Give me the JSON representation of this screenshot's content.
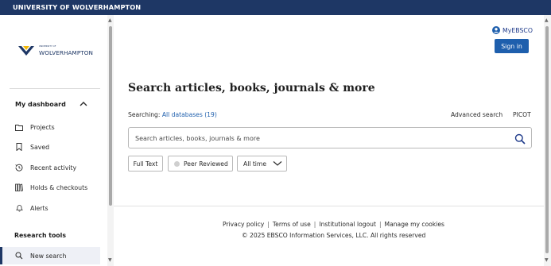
{
  "topbar": {
    "title": "UNIVERSITY OF WOLVERHAMPTON"
  },
  "logo": {
    "small_text": "UNIVERSITY OF",
    "name": "WOLVERHAMPTON"
  },
  "sidebar": {
    "dashboard_heading": "My dashboard",
    "items": [
      {
        "label": "Projects",
        "icon": "folder-icon"
      },
      {
        "label": "Saved",
        "icon": "bookmark-icon"
      },
      {
        "label": "Recent activity",
        "icon": "history-icon"
      },
      {
        "label": "Holds & checkouts",
        "icon": "books-icon"
      },
      {
        "label": "Alerts",
        "icon": "bell-icon"
      }
    ],
    "tools_heading": "Research tools",
    "active_item": {
      "label": "New search",
      "icon": "search-icon"
    }
  },
  "header": {
    "myebsco_label": "MyEBSCO",
    "signin_label": "Sign in"
  },
  "main": {
    "title": "Search articles, books, journals & more",
    "searching_label": "Searching:",
    "databases_link": "All databases (19)",
    "advanced_search": "Advanced search",
    "picot": "PICOT",
    "search": {
      "placeholder": "Search articles, books, journals & more",
      "value": ""
    },
    "filters": {
      "full_text": "Full Text",
      "peer_reviewed": "Peer Reviewed",
      "date": "All time"
    }
  },
  "footer": {
    "links": [
      "Privacy policy",
      "Terms of use",
      "Institutional logout",
      "Manage my cookies"
    ],
    "copyright": "© 2025 EBSCO Information Services, LLC. All rights reserved"
  },
  "colors": {
    "brand": "#1e3765",
    "accent": "#1e5fad",
    "link": "#1e3a8a"
  }
}
